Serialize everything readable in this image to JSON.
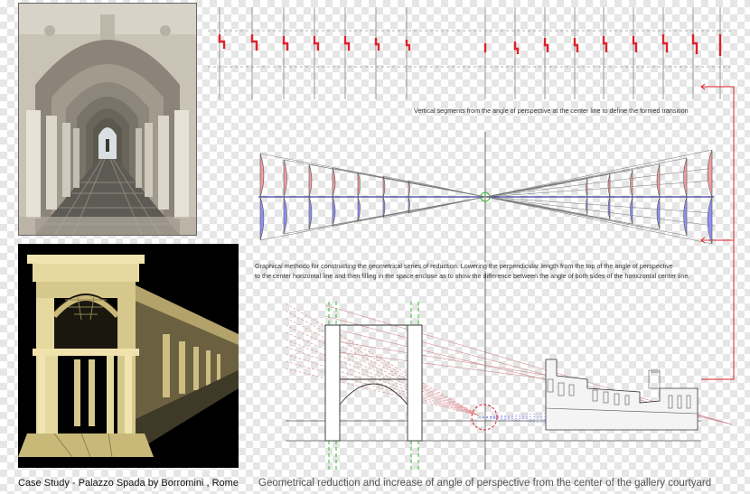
{
  "captions": {
    "vertical_segments": "Vertical segments from the angle of perspective at the center line  to define  the formed  transition",
    "graphical_method_line1": "Graphical methodo for constructing the geometrical series of reduction. Lowering the perpendicular length from the top of the angle of perspective",
    "graphical_method_line2": "to the center horizontal line and then filling in the space enclose as to show the difference between the angle of both sides of the horixzontal center line.",
    "case_study": "Case Study - Palazzo Spada by Borromini , Rome",
    "main_title": "Geometrical reduction and increase of angle of perspective  from the center of the gallery courtyard"
  },
  "colors": {
    "red_accent": "#e0202a",
    "blue_fill": "#8f8ff5",
    "pink_fill": "#f29aa0",
    "green_guide": "#2fbf2f",
    "stone": "#e6d9a0"
  },
  "images": {
    "photo": "palazzo-spada-gallery-photo",
    "render": "palazzo-spada-3d-model-render"
  }
}
